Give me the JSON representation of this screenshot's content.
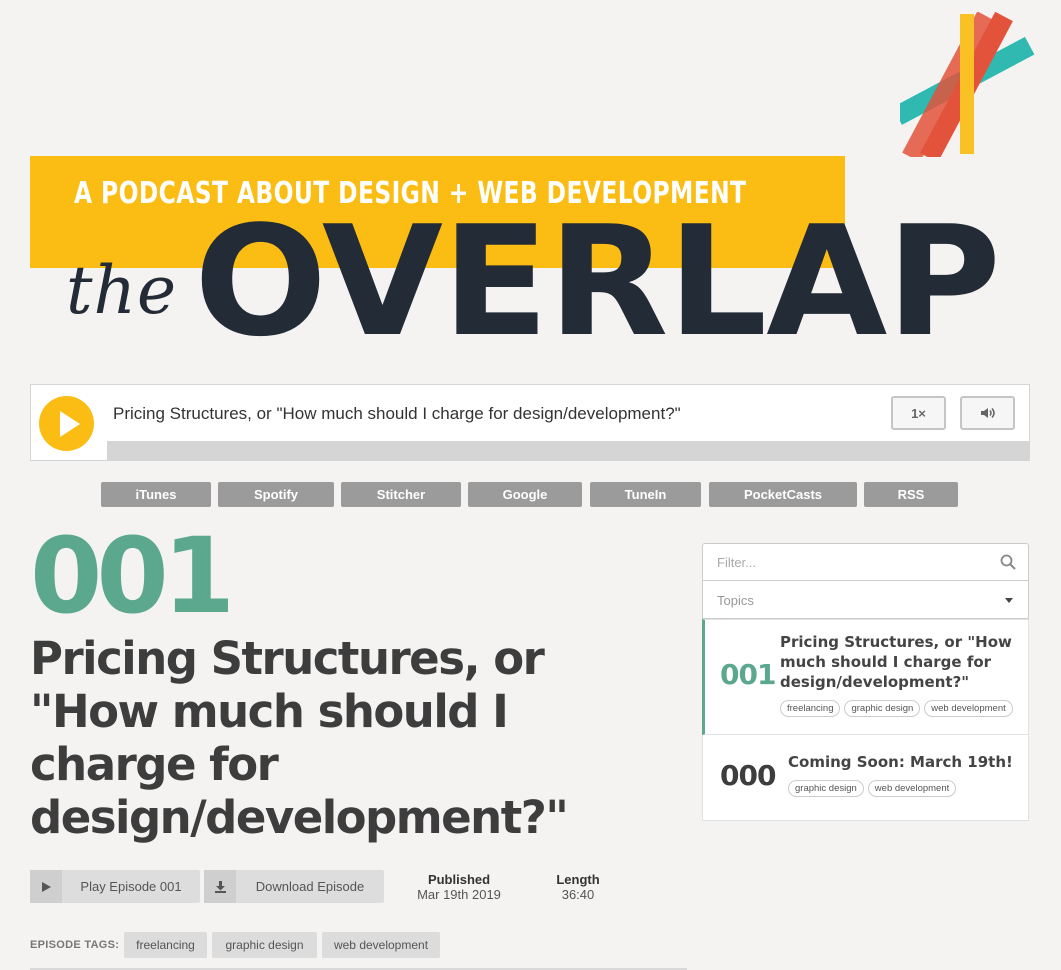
{
  "header": {
    "tagline": "A PODCAST ABOUT DESIGN + WEB DEVELOPMENT",
    "logo_the": "the",
    "logo_overlap": "OVERLAP"
  },
  "player": {
    "title": "Pricing Structures, or \"How much should I charge for design/development?\"",
    "speed": "1×",
    "progress_fraction": 0
  },
  "subscribe": {
    "links": [
      "iTunes",
      "Spotify",
      "Stitcher",
      "Google",
      "TuneIn",
      "PocketCasts",
      "RSS"
    ]
  },
  "episode": {
    "number": "001",
    "title": "Pricing Structures, or \"How much should I charge for design/development?\"",
    "play_label": "Play Episode 001",
    "download_label": "Download Episode",
    "published_label": "Published",
    "published_value": "Mar 19th 2019",
    "length_label": "Length",
    "length_value": "36:40",
    "tags_label": "EPISODE TAGS:",
    "tags": [
      "freelancing",
      "graphic design",
      "web development"
    ]
  },
  "sidebar": {
    "filter_placeholder": "Filter...",
    "topics_label": "Topics",
    "episodes": [
      {
        "number": "001",
        "title": "Pricing Structures, or \"How much should I charge for design/development?\"",
        "tags": [
          "freelancing",
          "graphic design",
          "web development"
        ]
      },
      {
        "number": "000",
        "title": "Coming Soon: March 19th!",
        "tags": [
          "graphic design",
          "web development"
        ]
      }
    ]
  },
  "colors": {
    "accent_yellow": "#fbbd14",
    "accent_green": "#5ba88f",
    "navy": "#232c36",
    "teal": "#1fb5ac",
    "red": "#e2452b"
  }
}
